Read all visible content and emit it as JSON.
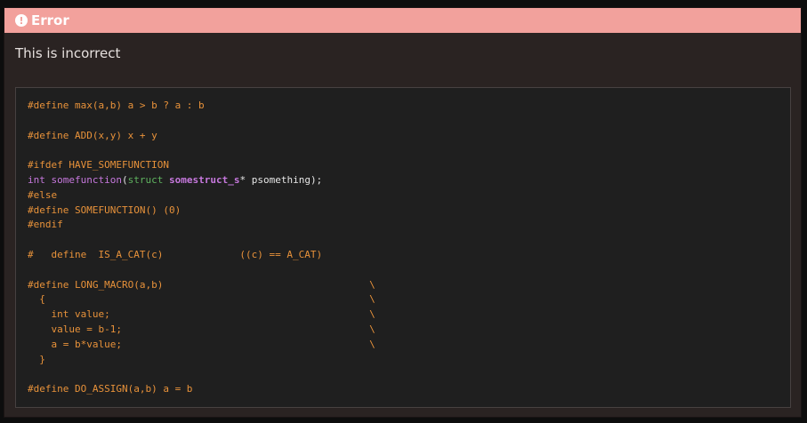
{
  "header": {
    "icon": "exclamation-circle-icon",
    "title": "Error"
  },
  "message": "This is incorrect",
  "code": {
    "line1": "#define max(a,b) a > b ? a : b",
    "line2": "",
    "line3": "#define ADD(x,y) x + y",
    "line4": "",
    "line5": "#ifdef HAVE_SOMEFUNCTION",
    "line6_kw": "int",
    "line6_fn": "somefunction",
    "line6_paren": "(",
    "line6_struct": "struct",
    "line6_type": "somestruct_s",
    "line6_rest": "* psomething);",
    "line7": "#else",
    "line8": "#define SOMEFUNCTION() (0)",
    "line9": "#endif",
    "line10": "",
    "line11": "#   define  IS_A_CAT(c)             ((c) == A_CAT)",
    "line12": "",
    "line13": "#define LONG_MACRO(a,b)                                   \\",
    "line14": "  {                                                       \\",
    "line15": "    int value;                                            \\",
    "line16": "    value = b-1;                                          \\",
    "line17": "    a = b*value;                                          \\",
    "line18": "  }",
    "line19": "",
    "line20": "#define DO_ASSIGN(a,b) a = b"
  },
  "colors": {
    "header_bg": "#f2a19c",
    "panel_bg": "#2a2322",
    "code_bg": "#1f1f1f",
    "macro": "#e8923a",
    "keyword": "#c678dd",
    "struct": "#5fb35f"
  }
}
